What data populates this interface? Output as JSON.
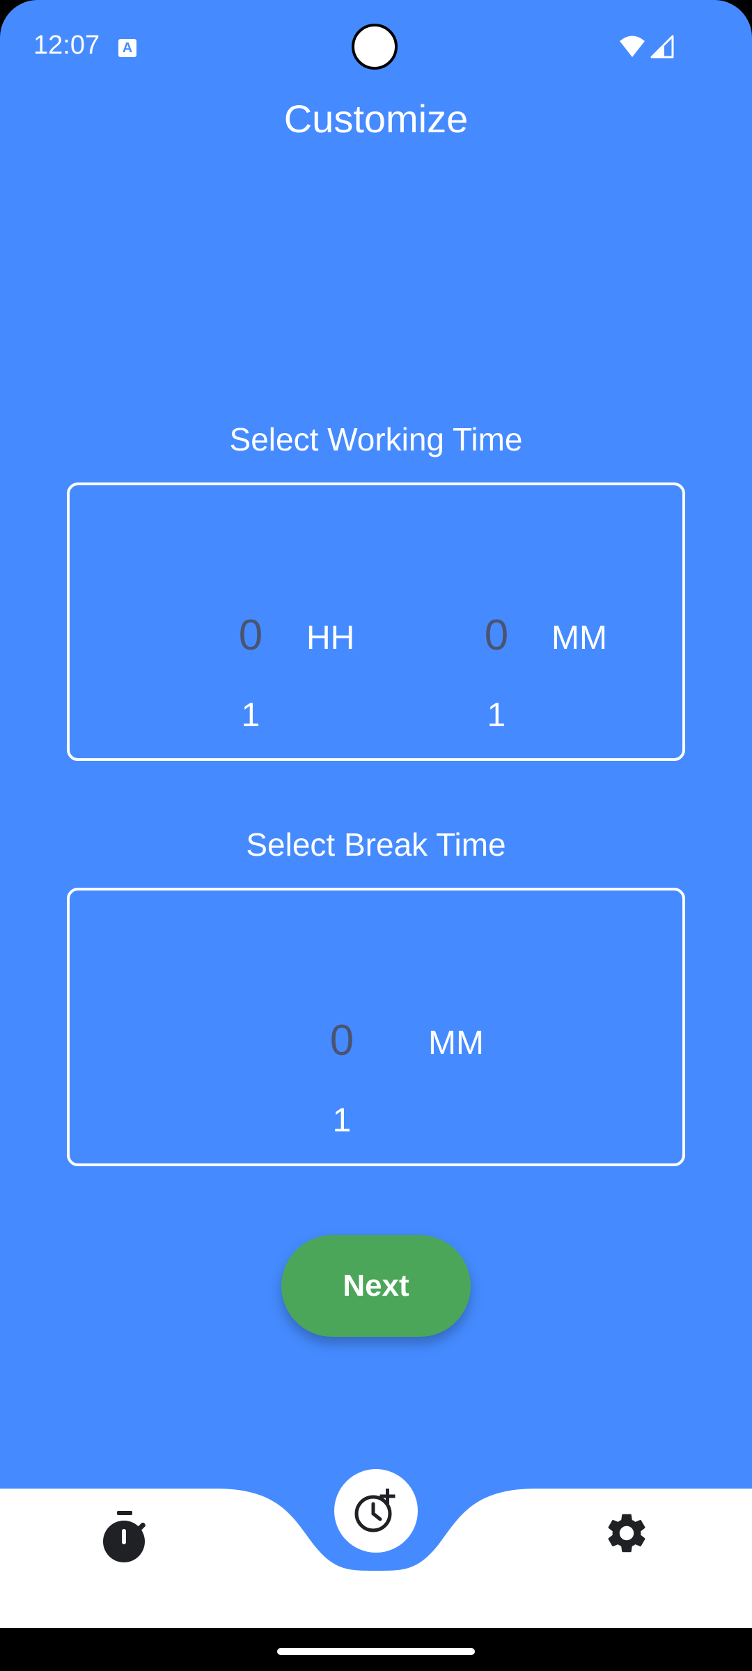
{
  "status_bar": {
    "time": "12:07",
    "notif_icon": "A"
  },
  "header": {
    "title": "Customize"
  },
  "working_time": {
    "label": "Select Working Time",
    "hours": {
      "selected": "0",
      "next": "1",
      "unit": "HH"
    },
    "minutes": {
      "selected": "0",
      "next": "1",
      "unit": "MM"
    }
  },
  "break_time": {
    "label": "Select Break Time",
    "minutes": {
      "selected": "0",
      "next": "1",
      "unit": "MM"
    }
  },
  "next_button": {
    "label": "Next"
  },
  "bottom_nav": {
    "items": [
      {
        "icon": "stopwatch-icon"
      },
      {
        "icon": "add-alarm-icon",
        "active": true
      },
      {
        "icon": "gear-icon"
      }
    ]
  },
  "colors": {
    "background": "#458BFF",
    "button": "#4CA65A",
    "wheel_selected": "#4a5470"
  }
}
